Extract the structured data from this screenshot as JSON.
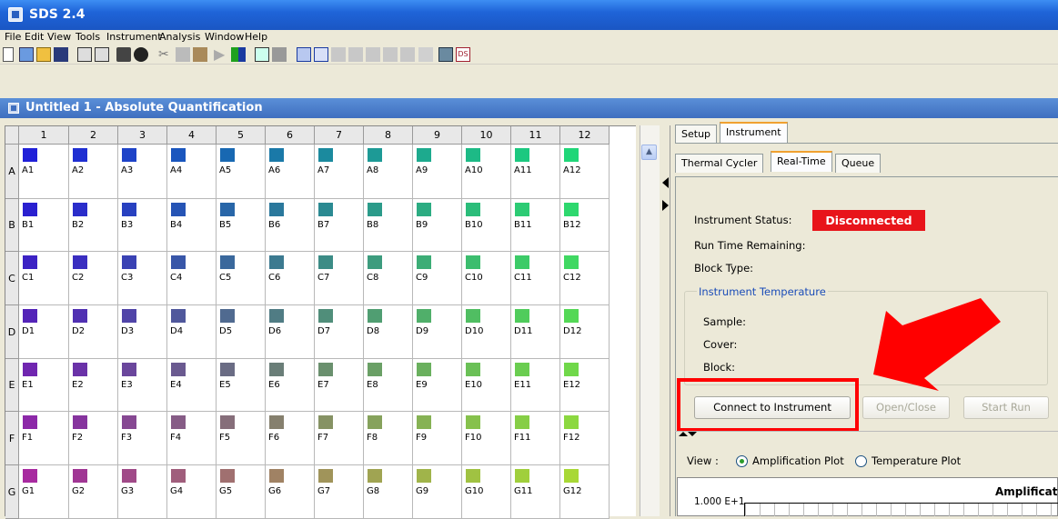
{
  "app": {
    "title": "SDS 2.4"
  },
  "menu": [
    "File",
    "Edit",
    "View",
    "Tools",
    "Instrument",
    "Analysis",
    "Window",
    "Help"
  ],
  "document": {
    "title": "Untitled 1 - Absolute Quantification"
  },
  "plate": {
    "columns": [
      "1",
      "2",
      "3",
      "4",
      "5",
      "6",
      "7",
      "8",
      "9",
      "10",
      "11",
      "12"
    ],
    "rows": [
      "A",
      "B",
      "C",
      "D",
      "E",
      "F",
      "G"
    ],
    "wells": [
      [
        "A1",
        "A2",
        "A3",
        "A4",
        "A5",
        "A6",
        "A7",
        "A8",
        "A9",
        "A10",
        "A11",
        "A12"
      ],
      [
        "B1",
        "B2",
        "B3",
        "B4",
        "B5",
        "B6",
        "B7",
        "B8",
        "B9",
        "B10",
        "B11",
        "B12"
      ],
      [
        "C1",
        "C2",
        "C3",
        "C4",
        "C5",
        "C6",
        "C7",
        "C8",
        "C9",
        "C10",
        "C11",
        "C12"
      ],
      [
        "D1",
        "D2",
        "D3",
        "D4",
        "D5",
        "D6",
        "D7",
        "D8",
        "D9",
        "D10",
        "D11",
        "D12"
      ],
      [
        "E1",
        "E2",
        "E3",
        "E4",
        "E5",
        "E6",
        "E7",
        "E8",
        "E9",
        "E10",
        "E11",
        "E12"
      ],
      [
        "F1",
        "F2",
        "F3",
        "F4",
        "F5",
        "F6",
        "F7",
        "F8",
        "F9",
        "F10",
        "F11",
        "F12"
      ],
      [
        "G1",
        "G2",
        "G3",
        "G4",
        "G5",
        "G6",
        "G7",
        "G8",
        "G9",
        "G10",
        "G11",
        "G12"
      ]
    ],
    "colors": [
      [
        "#2020d8",
        "#1f2fd2",
        "#1e43c8",
        "#1a56be",
        "#1868b2",
        "#1a79a8",
        "#1b8a9e",
        "#1d9a96",
        "#1daa8e",
        "#1dba86",
        "#1cc880",
        "#20d678"
      ],
      [
        "#2a20d0",
        "#2a2dca",
        "#2841c0",
        "#2654b5",
        "#2866a8",
        "#2a789c",
        "#2b8a92",
        "#2b9b8a",
        "#2cac82",
        "#2bbd7a",
        "#2ccb74",
        "#2ed86e"
      ],
      [
        "#3c22c4",
        "#3a2ec0",
        "#3a42b4",
        "#3856a8",
        "#3a689c",
        "#3c7a90",
        "#3c8c86",
        "#3d9c7e",
        "#3cad76",
        "#3cbd6e",
        "#3ccb68",
        "#40d862"
      ],
      [
        "#5424b8",
        "#5030b2",
        "#5044a8",
        "#50589c",
        "#506a90",
        "#507c84",
        "#508e7a",
        "#509e72",
        "#50af6a",
        "#50be62",
        "#50cc5c",
        "#54d856"
      ],
      [
        "#7026b0",
        "#6a32a8",
        "#6a469c",
        "#6a5a90",
        "#6a6c84",
        "#6a7e78",
        "#6a906e",
        "#6aa066",
        "#6ab05e",
        "#6ac056",
        "#6acd50",
        "#70d84a"
      ],
      [
        "#8c28a8",
        "#86349e",
        "#864892",
        "#865c86",
        "#866e7a",
        "#86806e",
        "#869264",
        "#86a25c",
        "#86b254",
        "#86c14c",
        "#86ce46",
        "#8cd840"
      ],
      [
        "#a82aa0",
        "#a03694",
        "#a04a88",
        "#a05e7c",
        "#a07070",
        "#a08264",
        "#a0945a",
        "#a0a452",
        "#a0b44a",
        "#a0c242",
        "#a0cf3c",
        "#a8d836"
      ]
    ]
  },
  "right_panel": {
    "outer_tabs": [
      "Setup",
      "Instrument"
    ],
    "inner_tabs": [
      "Thermal Cycler",
      "Real-Time",
      "Queue"
    ],
    "instrument_status_label": "Instrument Status:",
    "instrument_status_value": "Disconnected",
    "run_time_label": "Run Time Remaining:",
    "block_type_label": "Block Type:",
    "temperature_group": "Instrument Temperature",
    "sample_label": "Sample:",
    "cover_label": "Cover:",
    "block_label": "Block:",
    "connect_button": "Connect to Instrument",
    "open_close_button": "Open/Close",
    "start_run_button": "Start Run",
    "view_label": "View :",
    "view_options": [
      "Amplification Plot",
      "Temperature Plot"
    ],
    "selected_view": "Amplification Plot",
    "plot_title": "Amplificat",
    "plot_y_tick": "1.000 E+1"
  },
  "annotation_color": "#ff0000"
}
